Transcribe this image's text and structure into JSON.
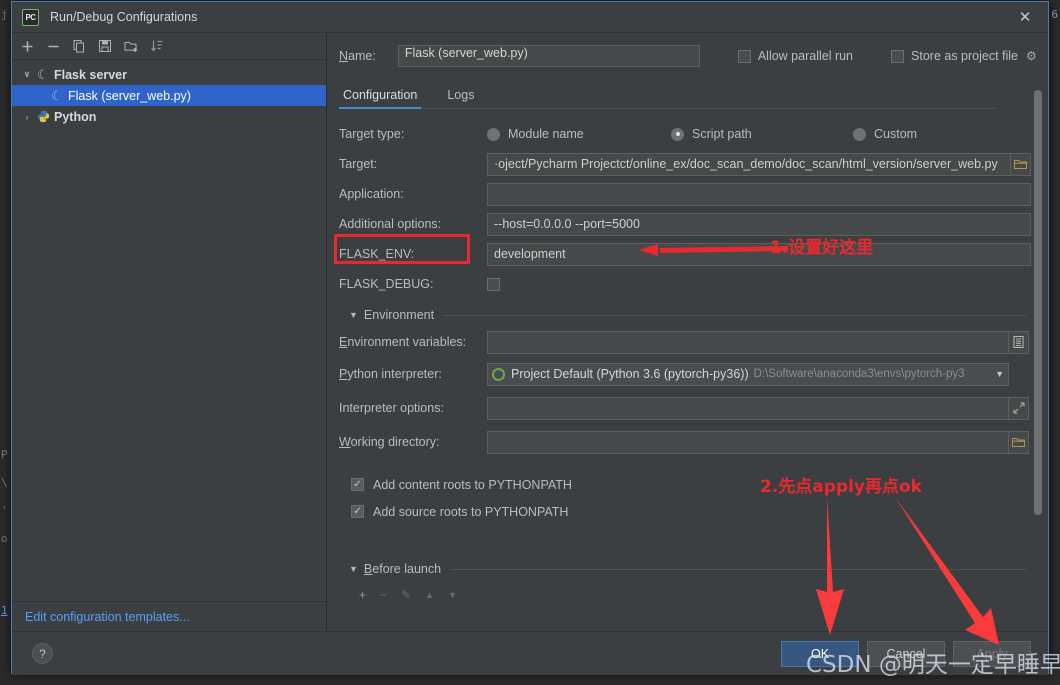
{
  "window": {
    "title": "Run/Debug Configurations",
    "app_icon": "pycharm-logo-icon",
    "close_label": "✕"
  },
  "sidebar": {
    "toolbar": [
      {
        "name": "add-configuration-button",
        "glyph": "+"
      },
      {
        "name": "remove-configuration-button",
        "glyph": "−"
      },
      {
        "name": "copy-configuration-button",
        "glyph": "copy-icon"
      },
      {
        "name": "save-configuration-button",
        "glyph": "save-icon"
      },
      {
        "name": "new-folder-button",
        "glyph": "folder-add-icon"
      },
      {
        "name": "sort-configurations-button",
        "glyph": "sort-icon"
      }
    ],
    "tree": [
      {
        "label": "Flask server",
        "twisty": "∨",
        "icon": "flask-icon",
        "level": 0,
        "selected": false,
        "bold": true
      },
      {
        "label": "Flask (server_web.py)",
        "twisty": "",
        "icon": "flask-icon",
        "level": 1,
        "selected": true,
        "bold": false
      },
      {
        "label": "Python",
        "twisty": "›",
        "icon": "python-icon",
        "level": 0,
        "selected": false,
        "bold": true
      }
    ],
    "edit_templates_link": "Edit configuration templates..."
  },
  "form": {
    "name_label": "Name:",
    "name_value": "Flask (server_web.py)",
    "allow_parallel_run": {
      "label": "Allow parallel run",
      "checked": false
    },
    "store_as_project_file": {
      "label": "Store as project file",
      "checked": false,
      "gear": "gear-icon"
    },
    "tabs": [
      {
        "label": "Configuration",
        "active": true
      },
      {
        "label": "Logs",
        "active": false
      }
    ],
    "target_type": {
      "label": "Target type:",
      "options": [
        "Module name",
        "Script path",
        "Custom"
      ],
      "selected": "Script path"
    },
    "target": {
      "label": "Target:",
      "value": "·oject/Pycharm Projectct/online_ex/doc_scan_demo/doc_scan/html_version/server_web.py",
      "browse_icon": "folder-icon"
    },
    "application": {
      "label": "Application:",
      "value": ""
    },
    "additional_options": {
      "label": "Additional options:",
      "value": "--host=0.0.0.0 --port=5000"
    },
    "flask_env": {
      "label": "FLASK_ENV:",
      "value": "development"
    },
    "flask_debug": {
      "label": "FLASK_DEBUG:",
      "checked": false
    },
    "environment_section": {
      "title": "Environment",
      "expanded": true,
      "twisty": "▼"
    },
    "environment_variables": {
      "label": "Environment variables:",
      "value": "",
      "edit_icon": "list-edit-icon"
    },
    "python_interpreter": {
      "label": "Python interpreter:",
      "value": "Project Default (Python 3.6 (pytorch-py36))",
      "path_hint": "D:\\Software\\anaconda3\\envs\\pytorch-py3",
      "arrow": "▼"
    },
    "interpreter_options": {
      "label": "Interpreter options:",
      "value": "",
      "expand_icon": "expand-icon"
    },
    "working_directory": {
      "label": "Working directory:",
      "value": "",
      "browse_icon": "folder-icon"
    },
    "add_content_roots": {
      "label": "Add content roots to PYTHONPATH",
      "checked": true
    },
    "add_source_roots": {
      "label": "Add source roots to PYTHONPATH",
      "checked": true
    },
    "before_launch": {
      "title": "Before launch",
      "twisty": "▼",
      "toolbar": [
        {
          "name": "before-launch-add-button",
          "glyph": "+"
        },
        {
          "name": "before-launch-remove-button",
          "glyph": "−"
        },
        {
          "name": "before-launch-edit-button",
          "glyph": "✎"
        },
        {
          "name": "before-launch-move-up-button",
          "glyph": "▲"
        },
        {
          "name": "before-launch-move-down-button",
          "glyph": "▼"
        }
      ]
    }
  },
  "footer": {
    "help_label": "?",
    "buttons": [
      {
        "label": "OK",
        "style": "primary"
      },
      {
        "label": "Cancel",
        "style": "default"
      },
      {
        "label": "Apply",
        "style": "disabled"
      }
    ]
  },
  "annotations": {
    "accent_color": "#e8292f",
    "note_1": "1.设置好这里",
    "note_2": "2.先点apply再点ok"
  },
  "watermark": "CSDN @明天一定早睡早起",
  "background_editor": {
    "left_gutter_lines": [
      "j",
      "",
      "",
      "",
      "P",
      "\\",
      "'",
      "o",
      "1"
    ],
    "right_edge_lines": [
      "6",
      "",
      "",
      "",
      "",
      ""
    ]
  }
}
